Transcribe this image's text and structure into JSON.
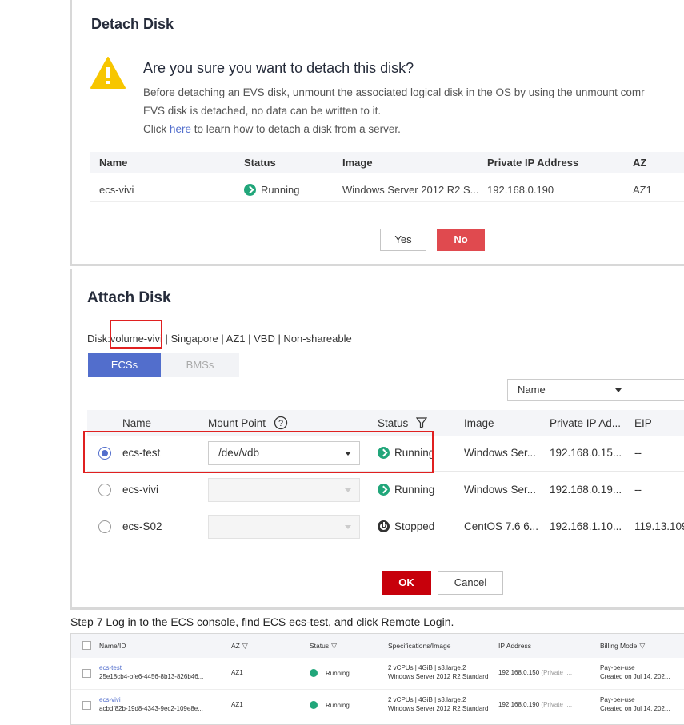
{
  "detach": {
    "title": "Detach Disk",
    "question": "Are you sure you want to detach this disk?",
    "desc_line1": "Before detaching an EVS disk, unmount the associated logical disk in the OS by using the unmount comr",
    "desc_line2": "EVS disk is detached, no data can be written to it.",
    "desc_click": "Click ",
    "desc_here": "here",
    "desc_rest": " to learn how to detach a disk from a server.",
    "columns": [
      "Name",
      "Status",
      "Image",
      "Private IP Address",
      "AZ"
    ],
    "row": {
      "name": "ecs-vivi",
      "status": "Running",
      "image": "Windows Server 2012 R2 S...",
      "ip": "192.168.0.190",
      "az": "AZ1"
    },
    "yes_label": "Yes",
    "no_label": "No"
  },
  "attach": {
    "title": "Attach Disk",
    "disk_prefix": "Disk:",
    "disk_name": "volume-vivi",
    "disk_rest": " | Singapore  | AZ1  | VBD  | Non-shareable",
    "tab_ecs": "ECSs",
    "tab_bms": "BMSs",
    "filter_select": "Name",
    "columns": {
      "name": "Name",
      "mount": "Mount Point",
      "status": "Status",
      "image": "Image",
      "ip": "Private IP Ad...",
      "eip": "EIP"
    },
    "rows": [
      {
        "name": "ecs-test",
        "mount": "/dev/vdb",
        "status": "Running",
        "image": "Windows Ser...",
        "ip": "192.168.0.15...",
        "eip": "--"
      },
      {
        "name": "ecs-vivi",
        "mount": "",
        "status": "Running",
        "image": "Windows Ser...",
        "ip": "192.168.0.19...",
        "eip": "--"
      },
      {
        "name": "ecs-S02",
        "mount": "",
        "status": "Stopped",
        "image": "CentOS 7.6 6...",
        "ip": "192.168.1.10...",
        "eip": "119.13.109"
      }
    ],
    "ok_label": "OK",
    "cancel_label": "Cancel"
  },
  "step_text": "Step 7 Log in to the ECS console, find ECS ecs-test, and click Remote Login.",
  "ecs_list": {
    "columns": {
      "name": "Name/ID",
      "az": "AZ",
      "status": "Status",
      "spec": "Specifications/Image",
      "ip": "IP Address",
      "billing": "Billing Mode"
    },
    "rows": [
      {
        "name": "ecs-test",
        "id": "25e18cb4-bfe6-4456-8b13-826b46...",
        "az": "AZ1",
        "status": "Running",
        "spec1": "2 vCPUs | 4GiB | s3.large.2",
        "spec2": "Windows Server 2012 R2 Standard",
        "ip": "192.168.0.150",
        "ip_note": "(Private I...",
        "billing1": "Pay-per-use",
        "billing2": "Created on Jul 14, 202..."
      },
      {
        "name": "ecs-vivi",
        "id": "acbdf82b-19d8-4343-9ec2-109e8e...",
        "az": "AZ1",
        "status": "Running",
        "spec1": "2 vCPUs | 4GiB | s3.large.2",
        "spec2": "Windows Server 2012 R2 Standard",
        "ip": "192.168.0.190",
        "ip_note": "(Private I...",
        "billing1": "Pay-per-use",
        "billing2": "Created on Jul 14, 202..."
      }
    ]
  }
}
